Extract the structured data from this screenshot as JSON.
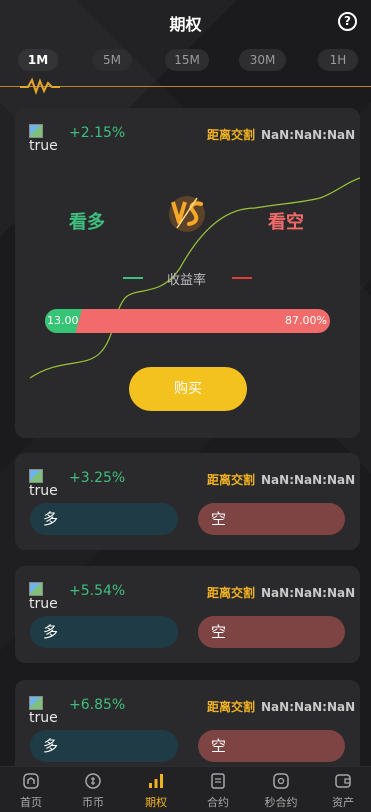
{
  "header": {
    "title": "期权",
    "help_icon": "question-circle-icon"
  },
  "period_tabs": [
    {
      "label": "1M",
      "active": true
    },
    {
      "label": "5M",
      "active": false
    },
    {
      "label": "15M",
      "active": false
    },
    {
      "label": "30M",
      "active": false
    },
    {
      "label": "1H",
      "active": false
    }
  ],
  "main_card": {
    "image_alt": "true",
    "change_pct": "+2.15%",
    "countdown_label": "距离交割",
    "countdown_value": "NaN:NaN:NaN",
    "long_label": "看多",
    "short_label": "看空",
    "vs_icon": "vs-icon",
    "legend_label": "收益率",
    "long_ratio_text": "13.00",
    "short_ratio_text": "87.00%",
    "long_ratio": 0.13,
    "buy_label": "购买"
  },
  "cards": [
    {
      "image_alt": "true",
      "change_pct": "+3.25%",
      "countdown_label": "距离交割",
      "countdown_value": "NaN:NaN:NaN",
      "long_label": "多",
      "short_label": "空"
    },
    {
      "image_alt": "true",
      "change_pct": "+5.54%",
      "countdown_label": "距离交割",
      "countdown_value": "NaN:NaN:NaN",
      "long_label": "多",
      "short_label": "空"
    },
    {
      "image_alt": "true",
      "change_pct": "+6.85%",
      "countdown_label": "距离交割",
      "countdown_value": "NaN:NaN:NaN",
      "long_label": "多",
      "short_label": "空"
    }
  ],
  "bottom_nav": [
    {
      "label": "首页",
      "icon": "home-icon",
      "active": false
    },
    {
      "label": "币币",
      "icon": "coin-icon",
      "active": false
    },
    {
      "label": "期权",
      "icon": "bar-chart-icon",
      "active": true
    },
    {
      "label": "合约",
      "icon": "contract-icon",
      "active": false
    },
    {
      "label": "秒合约",
      "icon": "target-icon",
      "active": false
    },
    {
      "label": "资产",
      "icon": "wallet-icon",
      "active": false
    }
  ],
  "colors": {
    "accent": "#f4c21f",
    "long": "#3fbf7f",
    "short": "#f26a6a",
    "countdown_label": "#f2b322"
  }
}
